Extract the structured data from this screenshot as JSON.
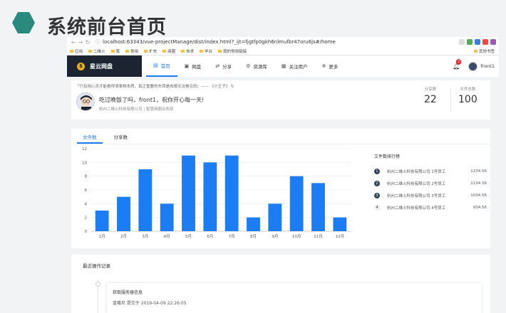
{
  "slide": {
    "title": "系统前台首页"
  },
  "browser": {
    "url": "localhost:63343/vue-projectManage/dist/index.html?_ijt=fjgtfp0gkh6nlmufbr47oru6js#/home",
    "bookmarks": [
      "应用",
      "二维火",
      "我",
      "常用",
      "扩充",
      "商圈",
      "技术",
      "毕业",
      "我的常用链接"
    ],
    "bookmarks_right": "其他书签"
  },
  "nav": {
    "logo": "星云网盘",
    "items": [
      {
        "label": "首页",
        "icon": "home-icon",
        "active": true
      },
      {
        "label": "网盘",
        "icon": "disk-icon",
        "active": false
      },
      {
        "label": "分享",
        "icon": "share-icon",
        "active": false
      },
      {
        "label": "资源库",
        "icon": "library-icon",
        "active": false
      },
      {
        "label": "关注用户",
        "icon": "users-icon",
        "active": false
      },
      {
        "label": "更多",
        "icon": "gear-icon",
        "active": false
      }
    ],
    "notif_count": "2",
    "username": "front1"
  },
  "profile": {
    "quote": "『只有用心灵才能看得清事物本质，真正重要的东西是肉眼无法看见的』—— 《小王子》",
    "greeting": "吃过晚饭了吗，front1，祝你开心每一天!",
    "company": "杭州二维火科技有限公司 | 智慧商圈业务部",
    "stats": [
      {
        "label": "分享数",
        "value": "22"
      },
      {
        "label": "文件总数",
        "value": "100"
      }
    ]
  },
  "chart_tabs": [
    "文件数",
    "分享数"
  ],
  "chart_data": {
    "type": "bar",
    "categories": [
      "1月",
      "2月",
      "3月",
      "4月",
      "5月",
      "6月",
      "7月",
      "8月",
      "9月",
      "10月",
      "11月",
      "12月"
    ],
    "values": [
      3,
      5,
      9,
      4,
      11,
      10,
      11,
      2,
      4,
      8,
      7,
      2
    ],
    "ylim": [
      0,
      12
    ],
    "yticks": [
      0,
      2,
      4,
      6,
      8,
      10,
      12
    ],
    "color": "#1c7cf4",
    "grid": true
  },
  "ranking": {
    "title": "文件数排行榜",
    "rows": [
      {
        "rank": "1",
        "name": "杭州二维火科技有限公司 1号员工",
        "value": "1234.56"
      },
      {
        "rank": "2",
        "name": "杭州二维火科技有限公司 2号员工",
        "value": "1134.56"
      },
      {
        "rank": "3",
        "name": "杭州二维火科技有限公司 3号员工",
        "value": "1034.56"
      },
      {
        "rank": "4",
        "name": "杭州二维火科技有限公司 4号员工",
        "value": "934.56"
      }
    ]
  },
  "log": {
    "title": "最近操作记录",
    "item_title": "获取服务器信息",
    "item_sub": "蓝羲尼 提交于 2019-04-09 22:26:05"
  }
}
